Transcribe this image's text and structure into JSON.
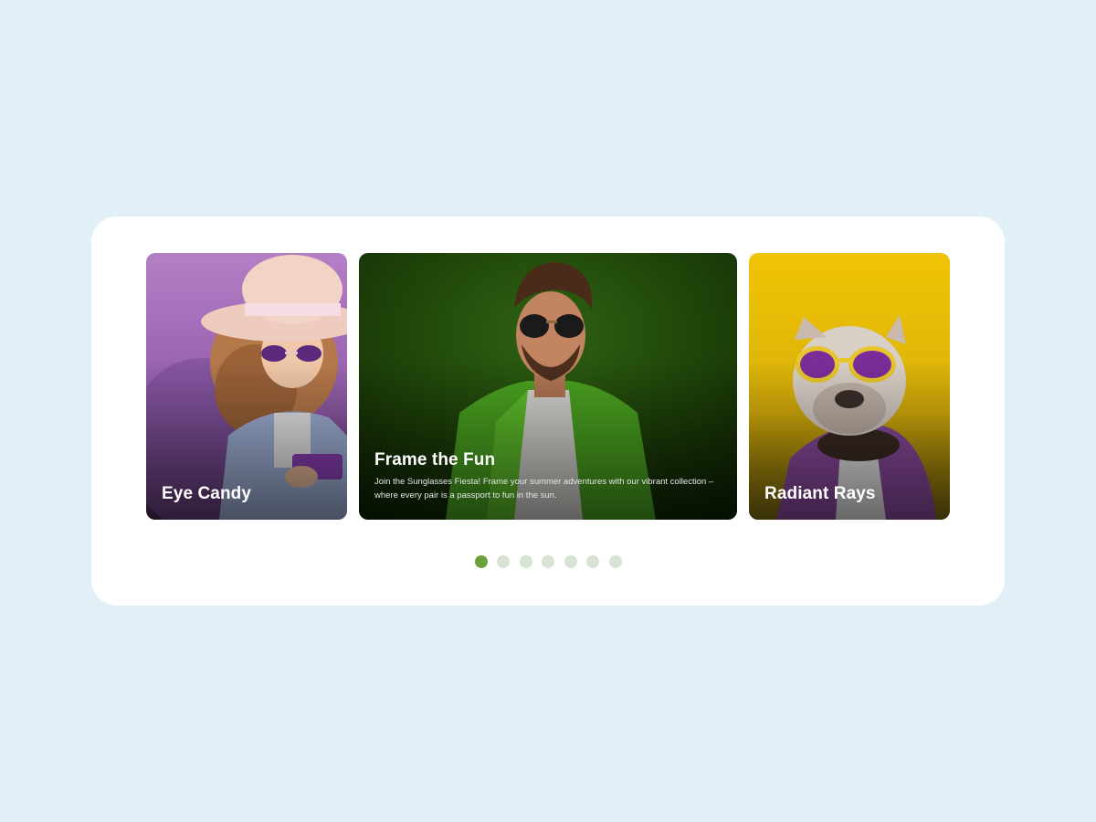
{
  "carousel": {
    "slides": [
      {
        "title": "Eye Candy",
        "description": "",
        "accent": "#b77fc8"
      },
      {
        "title": "Frame the Fun",
        "description": "Join the Sunglasses Fiesta! Frame your summer adventures with our vibrant collection – where every pair is a passport to fun in the sun.",
        "accent": "#2a5a0e"
      },
      {
        "title": "Radiant Rays",
        "description": "",
        "accent": "#e6bf05"
      }
    ],
    "pagination": {
      "total": 7,
      "active_index": 0,
      "active_color": "#6aa239",
      "inactive_color": "#d7e3d4"
    }
  },
  "colors": {
    "background": "#e1eff7",
    "panel": "#ffffff"
  }
}
